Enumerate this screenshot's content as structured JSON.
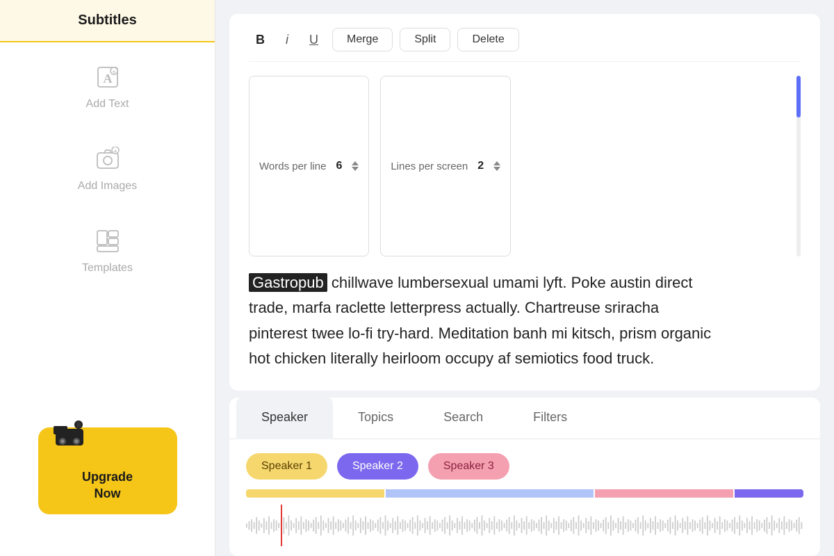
{
  "sidebar": {
    "subtitles_label": "Subtitles",
    "items": [
      {
        "id": "add-text",
        "label": "Add Text",
        "icon": "text-icon"
      },
      {
        "id": "add-images",
        "label": "Add Images",
        "icon": "camera-icon"
      },
      {
        "id": "templates",
        "label": "Templates",
        "icon": "templates-icon"
      }
    ],
    "upgrade": {
      "label": "Upgrade\nNow"
    }
  },
  "toolbar": {
    "bold_label": "B",
    "italic_label": "i",
    "underline_label": "U",
    "merge_label": "Merge",
    "split_label": "Split",
    "delete_label": "Delete"
  },
  "controls": {
    "words_per_line_label": "Words per line",
    "words_per_line_value": "6",
    "lines_per_screen_label": "Lines per screen",
    "lines_per_screen_value": "2"
  },
  "content": {
    "highlight": "Gastropub",
    "text": " chillwave lumbersexual umami lyft. Poke austin direct trade, marfa raclette letterpress actually. Chartreuse sriracha pinterest twee lo-fi try-hard. Meditation banh mi kitsch, prism organic hot chicken literally heirloom occupy af semiotics food truck."
  },
  "tabs": [
    {
      "id": "speaker",
      "label": "Speaker",
      "active": true
    },
    {
      "id": "topics",
      "label": "Topics",
      "active": false
    },
    {
      "id": "search",
      "label": "Search",
      "active": false
    },
    {
      "id": "filters",
      "label": "Filters",
      "active": false
    }
  ],
  "speakers": [
    {
      "id": "speaker1",
      "label": "Speaker 1",
      "color": "yellow"
    },
    {
      "id": "speaker2",
      "label": "Speaker 2",
      "color": "purple"
    },
    {
      "id": "speaker3",
      "label": "Speaker 3",
      "color": "pink"
    }
  ]
}
